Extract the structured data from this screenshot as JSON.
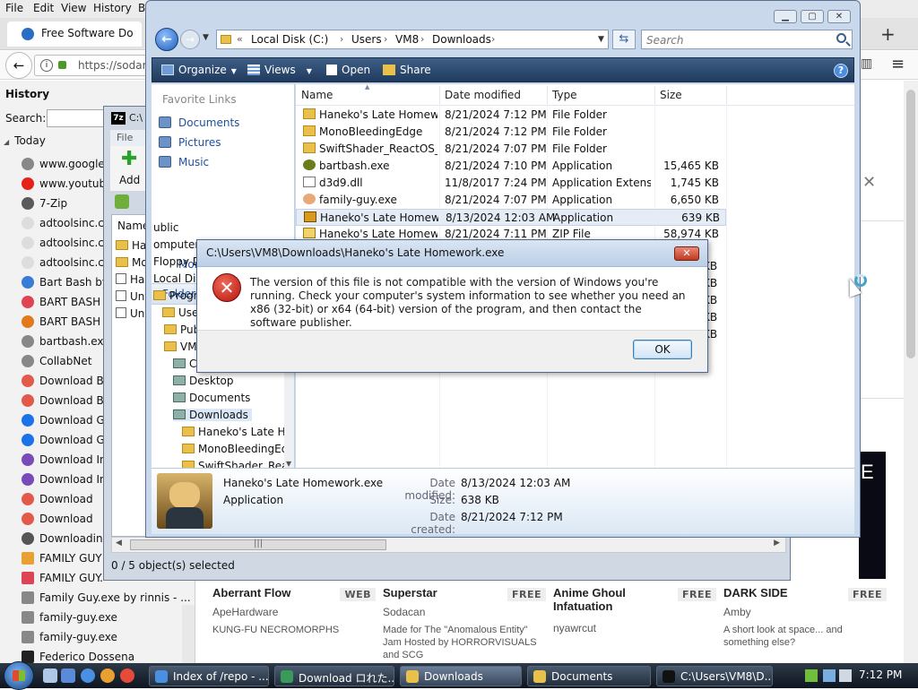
{
  "firefox": {
    "menu": [
      "File",
      "Edit",
      "View",
      "History",
      "B"
    ],
    "tab_title": "Free Software Do",
    "url": "https://sodara",
    "history": {
      "title": "History",
      "search_label": "Search:",
      "today_label": "Today",
      "items": [
        "www.google.c",
        "www.youtub",
        "7-Zip",
        "adtoolsinc.co",
        "adtoolsinc.co",
        "adtoolsinc.co",
        "Bart Bash by",
        "BART BASH I",
        "BART BASH d",
        "bartbash.exe",
        "CollabNet",
        "Download Ba",
        "Download Ba",
        "Download Go",
        "Download Go",
        "Download In",
        "Download In",
        "Download",
        "Download",
        "Downloading",
        "FAMILY GUY",
        "FAMILY GUY.",
        "Family Guy.exe by rinnis - ...",
        "family-guy.exe",
        "family-guy.exe",
        "Federico Dossena"
      ]
    },
    "banner_letter": "E",
    "cards": [
      {
        "name": "Aberrant Flow",
        "badge": "WEB",
        "by": "ApeHardware",
        "desc": "KUNG-FU NECROMORPHS"
      },
      {
        "name": "Superstar",
        "badge": "FREE",
        "by": "Sodacan",
        "desc": "Made for The \"Anomalous Entity\" Jam Hosted by HORRORVISUALS and SCG"
      },
      {
        "name": "Anime Ghoul Infatuation",
        "badge": "FREE",
        "by": "nyawrcut",
        "desc": ""
      },
      {
        "name": "DARK SIDE",
        "badge": "FREE",
        "by": "Amby",
        "desc": "A short look at space... and something else?"
      }
    ]
  },
  "sevenzip": {
    "title": "C:\\",
    "menu_file": "File",
    "add_label": "Add",
    "name_header": "Name",
    "rows": [
      "Ha",
      "Mo",
      "Ha",
      "Un",
      "Un"
    ],
    "status": "0 / 5 object(s) selected"
  },
  "explorer": {
    "breadcrumb": [
      "Local Disk (C:)",
      "Users",
      "VM8",
      "Downloads"
    ],
    "search_placeholder": "Search",
    "commands": {
      "organize": "Organize",
      "views": "Views",
      "open": "Open",
      "share": "Share"
    },
    "favorites_title": "Favorite Links",
    "favorites": [
      "Documents",
      "Pictures",
      "Music"
    ],
    "more_label": "More",
    "folders_label": "Folders",
    "tree": [
      "ublic",
      "omputer",
      "Floppy D",
      "Local Dis",
      "Progra",
      "Users",
      "Publi",
      "VM8",
      "Cor",
      "Desktop",
      "Documents",
      "Downloads",
      "Haneko's Late Hor",
      "MonoBleedingEdg",
      "SwiftShader_React"
    ],
    "columns": [
      "Name",
      "Date modified",
      "Type",
      "Size"
    ],
    "files": [
      {
        "name": "Haneko's Late Homew...",
        "date": "8/21/2024 7:12 PM",
        "type": "File Folder",
        "size": ""
      },
      {
        "name": "MonoBleedingEdge",
        "date": "8/21/2024 7:12 PM",
        "type": "File Folder",
        "size": ""
      },
      {
        "name": "SwiftShader_ReactOS_...",
        "date": "8/21/2024 7:07 PM",
        "type": "File Folder",
        "size": ""
      },
      {
        "name": "bartbash.exe",
        "date": "8/21/2024 7:10 PM",
        "type": "Application",
        "size": "15,465 KB"
      },
      {
        "name": "d3d9.dll",
        "date": "11/8/2017 7:24 PM",
        "type": "Application Extens...",
        "size": "1,745 KB"
      },
      {
        "name": "family-guy.exe",
        "date": "8/21/2024 7:07 PM",
        "type": "Application",
        "size": "6,650 KB"
      },
      {
        "name": "Haneko's Late Homew...",
        "date": "8/13/2024 12:03 AM",
        "type": "Application",
        "size": "639 KB"
      },
      {
        "name": "Haneko's Late Homew...",
        "date": "8/21/2024 7:11 PM",
        "type": "ZIP File",
        "size": "58,974 KB"
      }
    ],
    "partial_sizes": [
      "KB",
      "KB",
      "KB",
      "KB",
      "KB"
    ],
    "details": {
      "name": "Haneko's Late Homework.exe",
      "type": "Application",
      "modified_label": "Date modified:",
      "modified": "8/13/2024 12:03 AM",
      "size_label": "Size:",
      "size": "638 KB",
      "created_label": "Date created:",
      "created": "8/21/2024 7:12 PM"
    }
  },
  "dialog": {
    "title": "C:\\Users\\VM8\\Downloads\\Haneko's Late Homework.exe",
    "message": "The version of this file is not compatible with the version of Windows you're running. Check your computer's system information to see whether you need an x86 (32-bit) or x64 (64-bit) version of the program, and then contact the software publisher.",
    "ok_label": "OK"
  },
  "taskbar": {
    "buttons": [
      {
        "label": "Index of /repo - ...",
        "active": false
      },
      {
        "label": "Download ロれた...",
        "active": false
      },
      {
        "label": "Downloads",
        "active": true
      },
      {
        "label": "Documents",
        "active": false
      },
      {
        "label": "C:\\Users\\VM8\\D...",
        "active": false
      }
    ],
    "clock": "7:12 PM"
  }
}
